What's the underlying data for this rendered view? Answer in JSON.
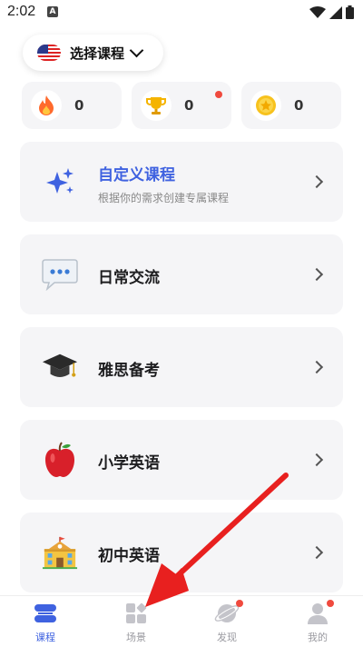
{
  "status_bar": {
    "time": "2:02",
    "notification_letter": "A"
  },
  "header": {
    "selector_label": "选择课程"
  },
  "stats": [
    {
      "icon": "fire-icon",
      "value": "0"
    },
    {
      "icon": "trophy-icon",
      "value": "0"
    },
    {
      "icon": "coin-icon",
      "value": "0"
    }
  ],
  "courses": [
    {
      "icon": "sparkle-icon",
      "title": "自定义课程",
      "subtitle": "根据你的需求创建专属课程"
    },
    {
      "icon": "speech-bubble-icon",
      "title": "日常交流"
    },
    {
      "icon": "graduation-cap-icon",
      "title": "雅思备考"
    },
    {
      "icon": "apple-icon",
      "title": "小学英语"
    },
    {
      "icon": "school-building-icon",
      "title": "初中英语"
    }
  ],
  "tabs": [
    {
      "label": "课程",
      "active": true
    },
    {
      "label": "场景",
      "active": false
    },
    {
      "label": "发现",
      "active": false
    },
    {
      "label": "我的",
      "active": false
    }
  ],
  "colors": {
    "accent": "#3f62e0",
    "badge": "#f04a3e",
    "annotation_arrow": "#e8201f"
  }
}
